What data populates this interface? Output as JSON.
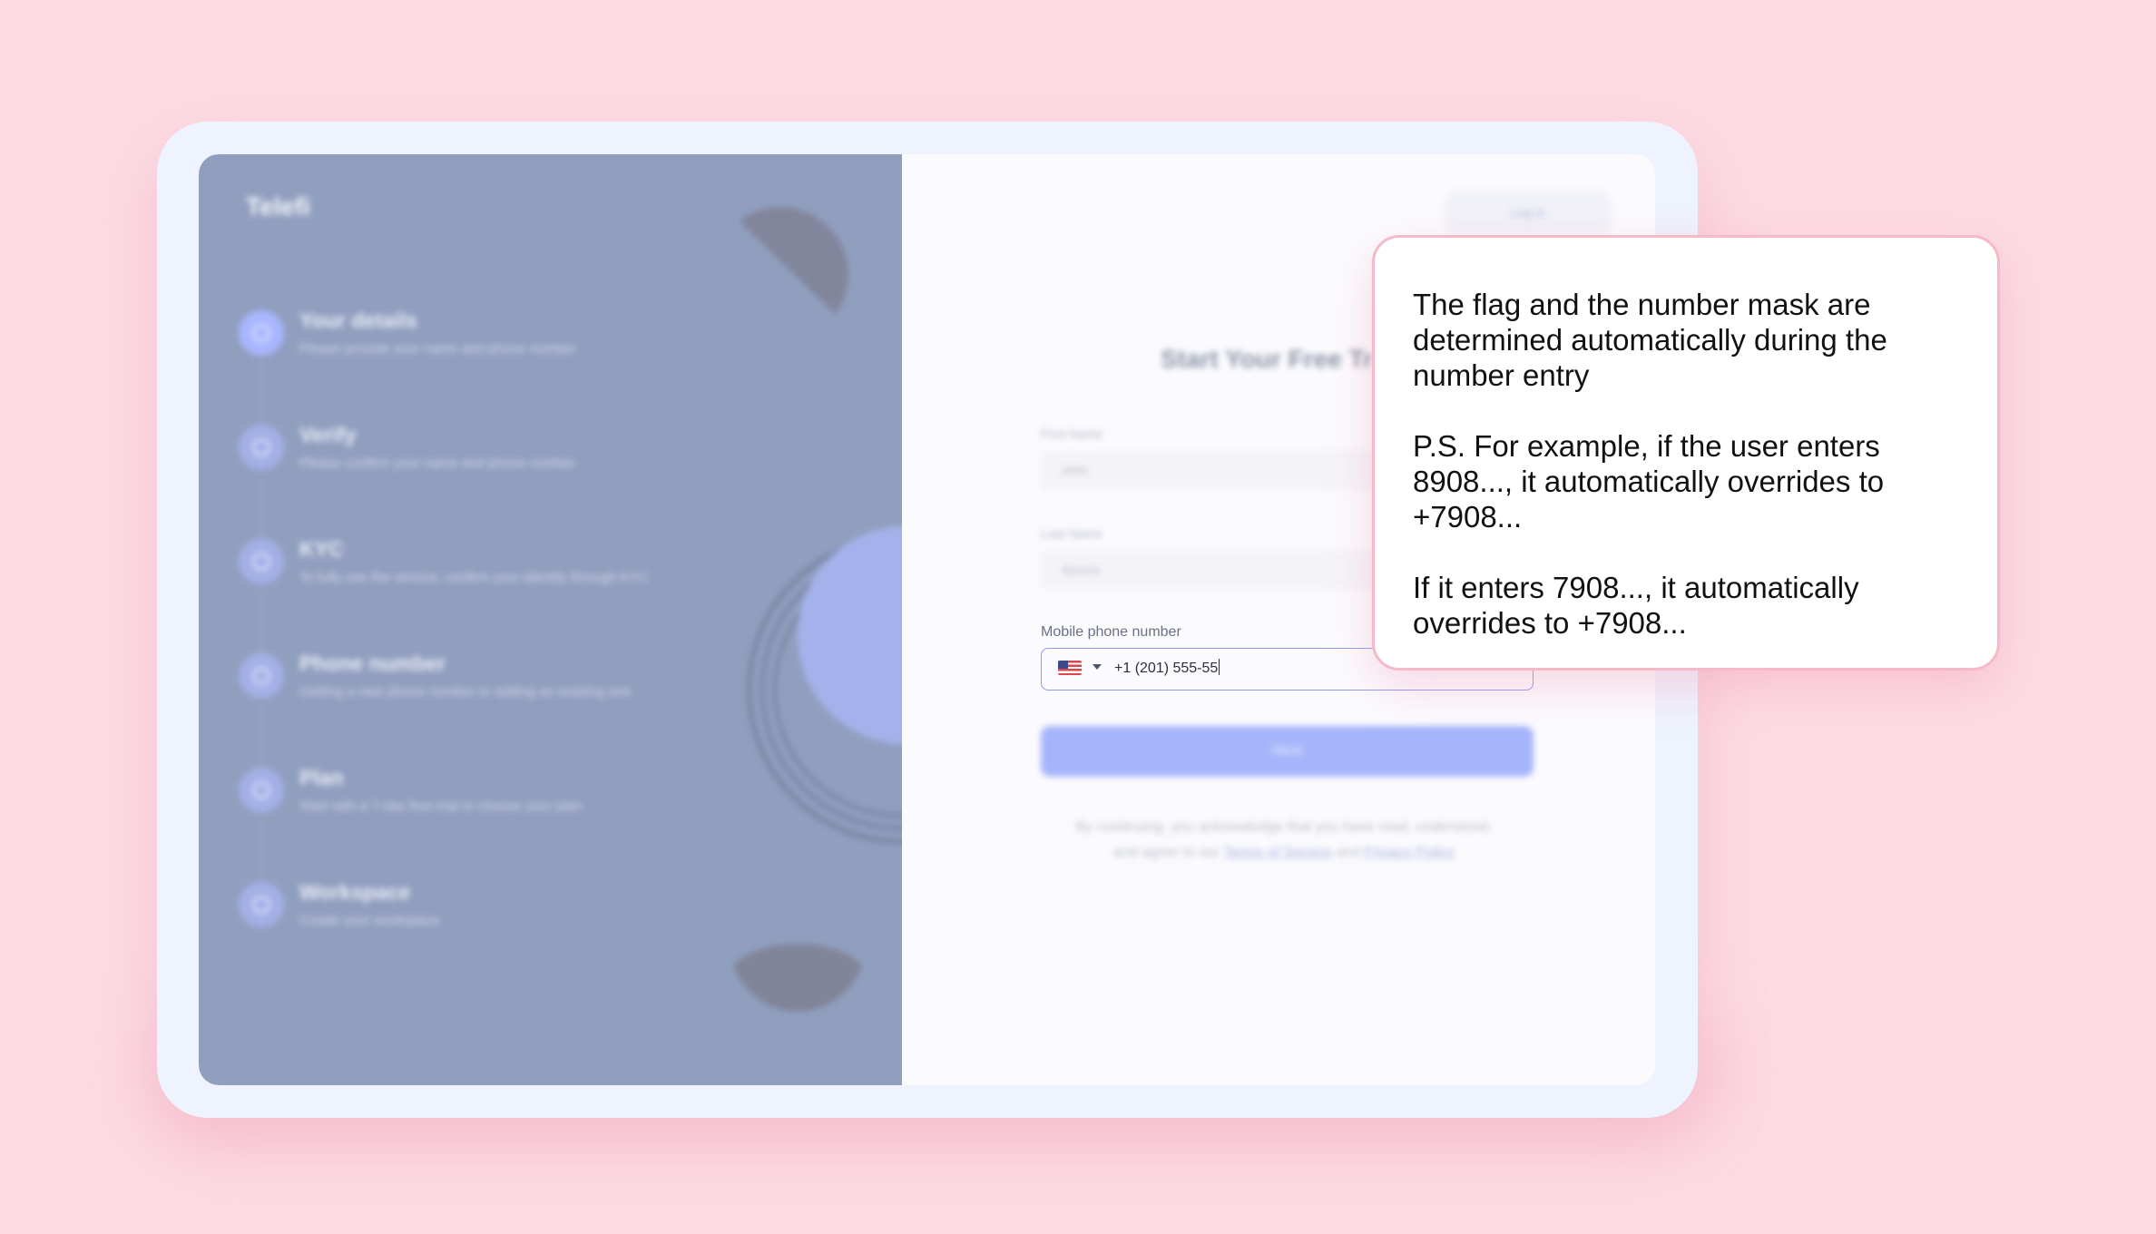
{
  "app": {
    "brand": "Telefi",
    "login_button": "Log in"
  },
  "sidebar": {
    "steps": [
      {
        "title": "Your details",
        "subtitle": "Please provide your name and phone number",
        "active": true
      },
      {
        "title": "Verify",
        "subtitle": "Please confirm your name and phone number",
        "active": false
      },
      {
        "title": "KYC",
        "subtitle": "To fully use the service, confirm your identity through KYC",
        "active": false
      },
      {
        "title": "Phone number",
        "subtitle": "Getting a new phone number or adding an existing one",
        "active": false
      },
      {
        "title": "Plan",
        "subtitle": "Start with a 7-day free trial or choose your plan",
        "active": false
      },
      {
        "title": "Workspace",
        "subtitle": "Create your workspace",
        "active": false
      }
    ]
  },
  "form": {
    "title": "Start Your Free Tr",
    "first_name": {
      "label": "First Name",
      "value": "John"
    },
    "last_name": {
      "label": "Last Name",
      "value": "Aboom"
    },
    "phone": {
      "label": "Mobile phone number",
      "country_flag": "us-flag-icon",
      "value": "+1 (201) 555-55"
    },
    "next_button": "Next",
    "legal": {
      "line1": "By continuing, you acknowledge that you have read, understood,",
      "line2_prefix": "and agree to our",
      "terms": "Terms of Service",
      "and": "and",
      "privacy": "Privacy Policy"
    }
  },
  "callout": {
    "p1": "The flag and the number mask are determined automatically during the number entry",
    "p2": "P.S. For example, if the user enters 8908..., it automatically overrides to +7908...",
    "p3": "If it enters 7908..., it automatically overrides to +7908..."
  },
  "colors": {
    "background": "#fcdbe3",
    "sidebar": "#919fbf",
    "accent": "#a6b5fa",
    "callout_border": "#f6b9c7"
  }
}
